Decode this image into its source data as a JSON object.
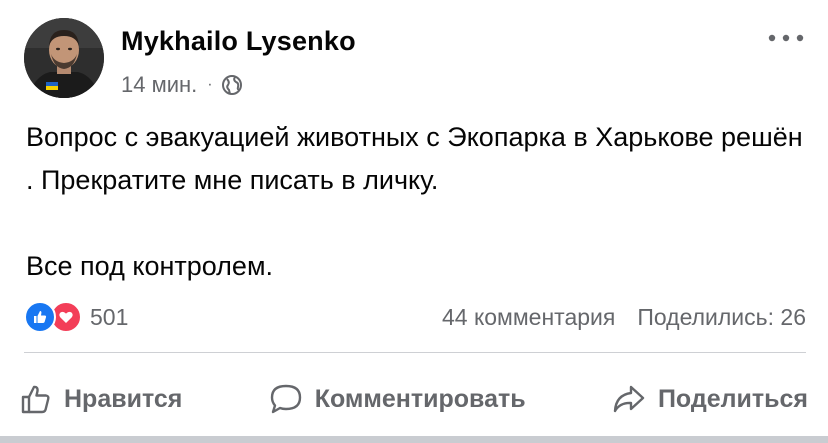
{
  "post": {
    "author": {
      "name": "Mykhailo Lysenko"
    },
    "timestamp": "14 мин.",
    "separator": "·",
    "audience_icon": "globe-icon",
    "more_icon": "more-options-icon",
    "text": {
      "paragraph_1": "Вопрос с эвакуацией животных с Экопарка в Харькове решён . Прекратите мне писать в личку.",
      "paragraph_2": "Все под контролем."
    },
    "stats": {
      "reaction_icons": [
        "like-reaction-icon",
        "love-reaction-icon"
      ],
      "reactions_count": "501",
      "comments": "44 комментария",
      "shares": "Поделились: 26"
    },
    "actions": {
      "like": {
        "label": "Нравится",
        "icon": "thumbs-up-icon"
      },
      "comment": {
        "label": "Комментировать",
        "icon": "comment-icon"
      },
      "share": {
        "label": "Поделиться",
        "icon": "share-icon"
      }
    }
  },
  "colors": {
    "text_primary": "#050505",
    "text_secondary": "#65676b",
    "like_blue": "#1877f2",
    "love_red": "#f33e58",
    "divider": "#ced0d4"
  }
}
